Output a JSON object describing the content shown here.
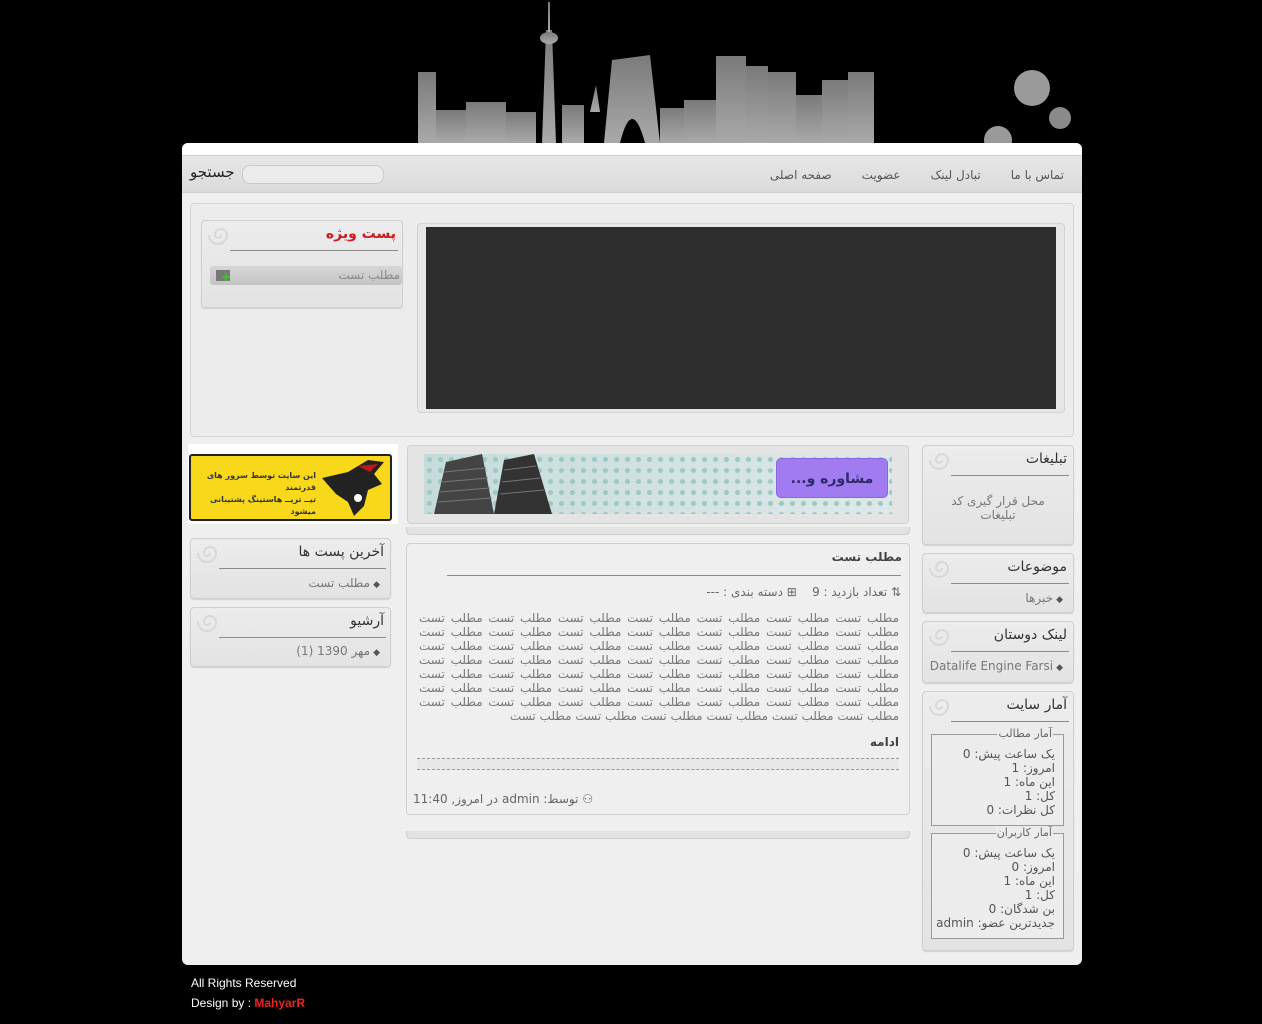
{
  "menu": {
    "items": [
      "صفحه اصلی",
      "عضویت",
      "تبادل لینک",
      "تماس با ما"
    ],
    "search_label": "جستجو"
  },
  "featured": {
    "title": "پست ویژه",
    "item": "مطلب تست"
  },
  "ad_banner": {
    "text_line1": "این سایت توسط سرور های قدرتمند",
    "text_line2": "تیــ تریــ هاستینگ پشتیبانی میشود"
  },
  "latest_posts": {
    "title": "آخرین پست ها",
    "items": [
      "مطلب تست"
    ]
  },
  "archive": {
    "title": "آرشیو",
    "items": [
      "مهر 1390 (1)"
    ]
  },
  "promo": {
    "label": "مشاوره و..."
  },
  "post": {
    "title": "مطلب تست",
    "views_label": "تعداد بازدید : 9",
    "category_label": "دسته بندی : ---",
    "body": "مطلب تست مطلب تست مطلب تست مطلب تست مطلب تست مطلب تست مطلب تست مطلب تست مطلب تست مطلب تست مطلب تست مطلب تست مطلب تست مطلب تست مطلب تست مطلب تست مطلب تست مطلب تست مطلب تست مطلب تست مطلب تست مطلب تست مطلب تست مطلب تست مطلب تست مطلب تست مطلب تست مطلب تست مطلب تست مطلب تست مطلب تست مطلب تست مطلب تست مطلب تست مطلب تست مطلب تست مطلب تست مطلب تست مطلب تست مطلب تست مطلب تست مطلب تست مطلب تست مطلب تست مطلب تست مطلب تست مطلب تست مطلب تست مطلب تست مطلب تست مطلب تست مطلب تست مطلب تست مطلب تست مطلب تست",
    "more": "ادامه",
    "footer": "توسط: admin در امروز, 11:40"
  },
  "ads": {
    "title": "تبلیغات",
    "text": "محل قرار گیری کد تبلیغات"
  },
  "topics": {
    "title": "موضوعات",
    "items": [
      "خبرها"
    ]
  },
  "friends": {
    "title": "لینک دوستان",
    "items": [
      "Datalife Engine Farsi"
    ]
  },
  "stats": {
    "title": "آمار سایت",
    "posts": {
      "legend": "آمار مطالب",
      "lines": [
        "یک ساعت پیش: 0",
        "امروز: 1",
        "این ماه: 1",
        "کل: 1",
        "کل نظرات: 0"
      ]
    },
    "users": {
      "legend": "آمار کاربران",
      "lines": [
        "یک ساعت پیش: 0",
        "امروز: 0",
        "این ماه: 1",
        "کل: 1",
        "بن شدگان: 0",
        "جدیدترین عضو: admin"
      ]
    }
  },
  "footer": {
    "rights": "All Rights Reserved",
    "design_by": "Design by :",
    "designer": "MahyarR"
  }
}
